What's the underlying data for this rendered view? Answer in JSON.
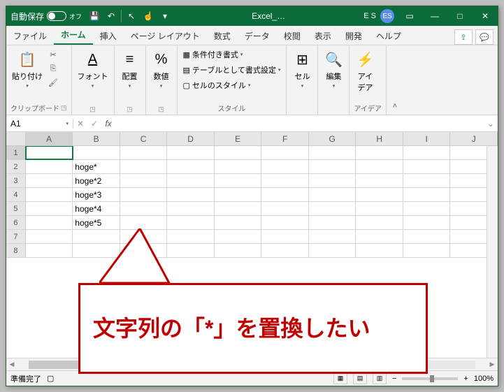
{
  "titlebar": {
    "autosave_label": "自動保存",
    "autosave_state": "オフ",
    "title": "Excel_…",
    "user_text": "E S",
    "user_initials": "ES"
  },
  "tabs": {
    "items": [
      "ファイル",
      "ホーム",
      "挿入",
      "ページ レイアウト",
      "数式",
      "データ",
      "校閲",
      "表示",
      "開発",
      "ヘルプ"
    ],
    "active": 1
  },
  "ribbon": {
    "clipboard": {
      "paste": "貼り付け",
      "label": "クリップボード"
    },
    "font": {
      "btn": "フォント"
    },
    "align": {
      "btn": "配置"
    },
    "number": {
      "btn": "数値"
    },
    "styles": {
      "cond": "条件付き書式",
      "tablefmt": "テーブルとして書式設定",
      "cellstyle": "セルのスタイル",
      "label": "スタイル"
    },
    "cells": {
      "btn": "セル"
    },
    "edit": {
      "btn": "編集"
    },
    "idea": {
      "btn": "アイ\nデア",
      "label": "アイデア"
    }
  },
  "namebox": {
    "ref": "A1",
    "formula": ""
  },
  "grid": {
    "cols": [
      "A",
      "B",
      "C",
      "D",
      "E",
      "F",
      "G",
      "H",
      "I",
      "J"
    ],
    "rows": [
      1,
      2,
      3,
      4,
      5,
      6,
      7,
      8
    ],
    "active": {
      "r": 1,
      "c": "A"
    },
    "cells": {
      "B2": "hoge*",
      "B3": "hoge*2",
      "B4": "hoge*3",
      "B5": "hoge*4",
      "B6": "hoge*5"
    }
  },
  "status": {
    "ready": "準備完了",
    "zoom": "100%"
  },
  "callout": {
    "text": "文字列の「*」を置換したい"
  }
}
